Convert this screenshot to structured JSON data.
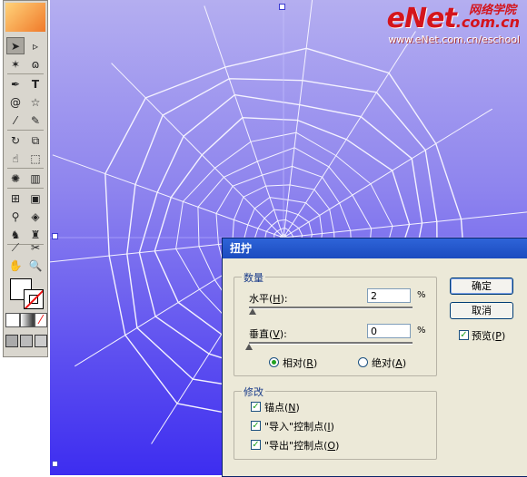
{
  "watermark": {
    "logo": "eNet",
    "dotcom": ".com.cn",
    "chinese": "网络学院",
    "url": "www.eNet.com.cn/eschool"
  },
  "toolbox": {
    "tools": [
      "selection-arrow",
      "direct-selection",
      "magic-wand",
      "lasso",
      "pen",
      "type",
      "spiral",
      "star",
      "paintbrush",
      "pencil",
      "rotate",
      "scale",
      "warp",
      "free-transform",
      "symbol-sprayer",
      "column-graph",
      "mesh",
      "gradient",
      "eyedropper",
      "blend",
      "live-paint-bucket",
      "live-paint-selection",
      "slice",
      "scissors",
      "hand",
      "zoom"
    ],
    "colors": {
      "fill": "#ffffff",
      "stroke_none": "#e11111"
    }
  },
  "dialog": {
    "title": "扭拧",
    "amount_group": {
      "label": "数量",
      "horizontal": {
        "label": "水平(",
        "key": "H",
        "suffix": "):",
        "value": "2",
        "unit": "%",
        "slider_fraction": 0.02
      },
      "vertical": {
        "label": "垂直(",
        "key": "V",
        "suffix": "):",
        "value": "0",
        "unit": "%",
        "slider_fraction": 0.0
      },
      "relative": {
        "label": "相对(",
        "key": "R",
        "suffix": ")",
        "selected": true
      },
      "absolute": {
        "label": "绝对(",
        "key": "A",
        "suffix": ")",
        "selected": false
      }
    },
    "modify_group": {
      "label": "修改",
      "anchor_points": {
        "label": "锚点(",
        "key": "N",
        "suffix": ")",
        "checked": true
      },
      "in_control_points": {
        "label": "\"导入\"控制点(",
        "key": "I",
        "suffix": ")",
        "checked": true
      },
      "out_control_points": {
        "label": "\"导出\"控制点(",
        "key": "O",
        "suffix": ")",
        "checked": true
      }
    },
    "buttons": {
      "ok": "确定",
      "cancel": "取消"
    },
    "preview": {
      "label": "预览(",
      "key": "P",
      "suffix": ")",
      "checked": true
    }
  }
}
